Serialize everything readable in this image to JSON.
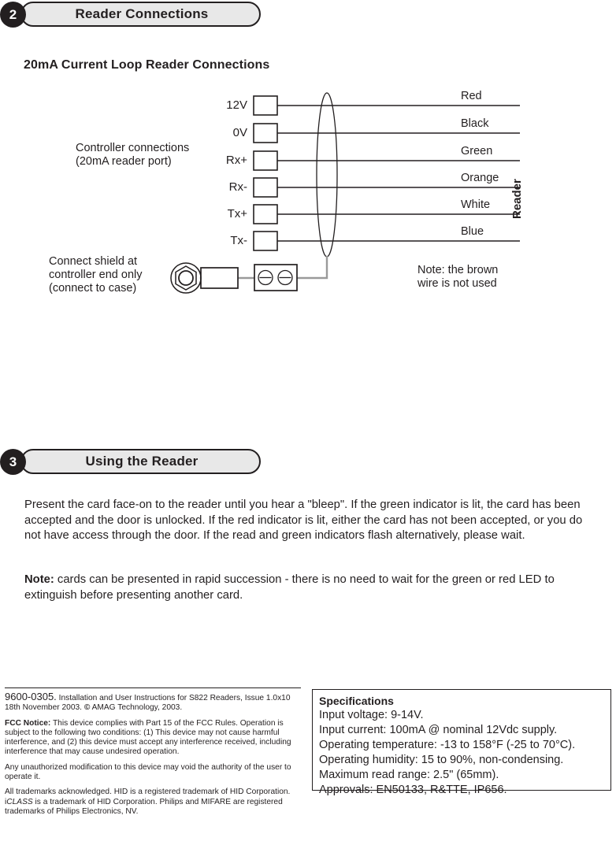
{
  "sections": [
    {
      "number": "2",
      "title": "Reader Connections"
    },
    {
      "number": "3",
      "title": "Using the Reader"
    }
  ],
  "diagram": {
    "heading": "20mA Current Loop Reader Connections",
    "controller_caption_line1": "Controller connections",
    "controller_caption_line2": "(20mA reader port)",
    "shield_caption_line1": "Connect shield at",
    "shield_caption_line2": "controller end only",
    "shield_caption_line3": "(connect to case)",
    "brown_note_line1": "Note: the brown",
    "brown_note_line2": "wire is not used",
    "reader_side_label": "Reader",
    "terminals": [
      "12V",
      "0V",
      "Rx+",
      "Rx-",
      "Tx+",
      "Tx-"
    ],
    "wire_colors": [
      "Red",
      "Black",
      "Green",
      "Orange",
      "White",
      "Blue"
    ]
  },
  "usage": {
    "paragraph": "Present the card face-on to the reader until you hear a \"bleep\". If the green indicator is lit, the card has been accepted and the door is unlocked. If the red indicator is lit, either the card has not been accepted, or you do not have access through the door. If the read and green indicators flash alternatively, please wait.",
    "note_lead": "Note:",
    "note_text": " cards can be presented in rapid succession - there is no need to wait for the green or red LED to extinguish before presenting another card."
  },
  "footer": {
    "doc_code": "9600-0305.",
    "doc_title": " Installation and User Instructions for S822 Readers, Issue 1.0x10 18th November 2003. ",
    "copyright_symbol": "©",
    "copyright_text": " AMAG Technology, 2003.",
    "fcc_lead": "FCC Notice:",
    "fcc_text": " This device complies with Part 15 of the FCC Rules. Operation is subject to the following two conditions: (1) This device may not cause harmful interference, and (2) this device must accept any interference received, including interference that may cause undesired operation.",
    "modification_text": "Any unauthorized modification to this device may void the authority of the user to operate it.",
    "trademark_pre": "All trademarks acknowledged. HID is a registered trademark of HID Corporation. i",
    "trademark_iclass": "CLASS",
    "trademark_post": " is a trademark of HID Corporation. Philips and MIFARE are registered trademarks of Philips Electronics, NV."
  },
  "specifications": {
    "title": "Specifications",
    "lines": [
      "Input voltage: 9-14V.",
      "Input current: 100mA @ nominal 12Vdc supply.",
      "Operating temperature: -13 to 158°F (-25 to 70°C).",
      "Operating humidity: 15 to 90%, non-condensing.",
      "Maximum read range: 2.5\" (65mm).",
      "Approvals: EN50133, R&TTE, IP656."
    ]
  },
  "colors": {
    "ink": "#231f20",
    "banner_fill": "#e8e8e8",
    "shield_wire": "#9a9a9a"
  }
}
